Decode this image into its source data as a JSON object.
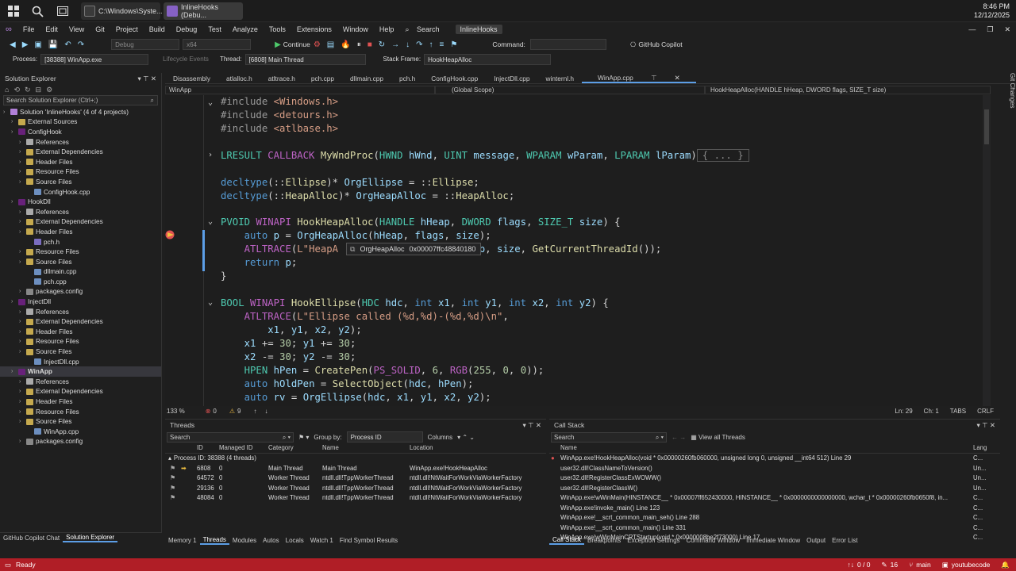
{
  "taskbar": {
    "tab1": "C:\\Windows\\Syste...",
    "tab2": "InlineHooks (Debu...",
    "time": "8:46 PM",
    "date": "12/12/2025"
  },
  "menu": [
    "File",
    "Edit",
    "View",
    "Git",
    "Project",
    "Build",
    "Debug",
    "Test",
    "Analyze",
    "Tools",
    "Extensions",
    "Window",
    "Help"
  ],
  "menu_search": "Search",
  "solution_badge": "InlineHooks",
  "toolbar": {
    "config": "Debug",
    "platform": "x64",
    "continue": "Continue",
    "command_label": "Command:",
    "copilot": "GitHub Copilot"
  },
  "procbar": {
    "process_label": "Process:",
    "process": "[38388] WinApp.exe",
    "lifecycle": "Lifecycle Events",
    "thread_label": "Thread:",
    "thread": "[6808] Main Thread",
    "frame_label": "Stack Frame:",
    "frame": "HookHeapAlloc"
  },
  "solution_explorer": {
    "title": "Solution Explorer",
    "search": "Search Solution Explorer (Ctrl+;)",
    "rows": [
      {
        "t": "Solution 'InlineHooks' (4 of 4 projects)",
        "d": 0,
        "c": "#b180d7"
      },
      {
        "t": "External Sources",
        "d": 1,
        "c": "#c5a94e"
      },
      {
        "t": "ConfigHook",
        "d": 1,
        "c": "#68217a"
      },
      {
        "t": "References",
        "d": 2,
        "c": "#aaaaaa"
      },
      {
        "t": "External Dependencies",
        "d": 2,
        "c": "#c5a94e"
      },
      {
        "t": "Header Files",
        "d": 2,
        "c": "#c5a94e"
      },
      {
        "t": "Resource Files",
        "d": 2,
        "c": "#c5a94e"
      },
      {
        "t": "Source Files",
        "d": 2,
        "c": "#c5a94e"
      },
      {
        "t": "ConfigHook.cpp",
        "d": 3,
        "c": "#6c8ebf"
      },
      {
        "t": "HookDll",
        "d": 1,
        "c": "#68217a"
      },
      {
        "t": "References",
        "d": 2,
        "c": "#aaaaaa"
      },
      {
        "t": "External Dependencies",
        "d": 2,
        "c": "#c5a94e"
      },
      {
        "t": "Header Files",
        "d": 2,
        "c": "#c5a94e"
      },
      {
        "t": "pch.h",
        "d": 3,
        "c": "#7a6cbf"
      },
      {
        "t": "Resource Files",
        "d": 2,
        "c": "#c5a94e"
      },
      {
        "t": "Source Files",
        "d": 2,
        "c": "#c5a94e"
      },
      {
        "t": "dllmain.cpp",
        "d": 3,
        "c": "#6c8ebf"
      },
      {
        "t": "pch.cpp",
        "d": 3,
        "c": "#6c8ebf"
      },
      {
        "t": "packages.config",
        "d": 2,
        "c": "#888888"
      },
      {
        "t": "InjectDll",
        "d": 1,
        "c": "#68217a"
      },
      {
        "t": "References",
        "d": 2,
        "c": "#aaaaaa"
      },
      {
        "t": "External Dependencies",
        "d": 2,
        "c": "#c5a94e"
      },
      {
        "t": "Header Files",
        "d": 2,
        "c": "#c5a94e"
      },
      {
        "t": "Resource Files",
        "d": 2,
        "c": "#c5a94e"
      },
      {
        "t": "Source Files",
        "d": 2,
        "c": "#c5a94e"
      },
      {
        "t": "InjectDll.cpp",
        "d": 3,
        "c": "#6c8ebf"
      },
      {
        "t": "WinApp",
        "d": 1,
        "c": "#68217a",
        "sel": true
      },
      {
        "t": "References",
        "d": 2,
        "c": "#aaaaaa"
      },
      {
        "t": "External Dependencies",
        "d": 2,
        "c": "#c5a94e"
      },
      {
        "t": "Header Files",
        "d": 2,
        "c": "#c5a94e"
      },
      {
        "t": "Resource Files",
        "d": 2,
        "c": "#c5a94e"
      },
      {
        "t": "Source Files",
        "d": 2,
        "c": "#c5a94e"
      },
      {
        "t": "WinApp.cpp",
        "d": 3,
        "c": "#6c8ebf"
      },
      {
        "t": "packages.config",
        "d": 2,
        "c": "#888888"
      }
    ],
    "bottom_tabs": [
      "GitHub Copilot Chat",
      "Solution Explorer"
    ]
  },
  "doc_tabs": [
    "Disassembly",
    "atlalloc.h",
    "atltrace.h",
    "pch.cpp",
    "dllmain.cpp",
    "pch.h",
    "ConfigHook.cpp",
    "InjectDll.cpp",
    "winternl.h",
    "WinApp.cpp"
  ],
  "navbar": {
    "project": "WinApp",
    "scope": "(Global Scope)",
    "member": "HookHeapAlloc(HANDLE hHeap, DWORD flags, SIZE_T size)"
  },
  "tooltip": {
    "name": "OrgHeapAlloc",
    "value": "0x00007ffc48840180"
  },
  "editor_status": {
    "zoom": "133 %",
    "errors": "0",
    "warnings": "9",
    "ln": "Ln: 29",
    "ch": "Ch: 1",
    "tabs": "TABS",
    "crlf": "CRLF"
  },
  "threads": {
    "title": "Threads",
    "search": "Search",
    "group_label": "Group by:",
    "group_value": "Process ID",
    "columns": "Columns",
    "headers": [
      "ID",
      "Managed ID",
      "Category",
      "Name",
      "Location"
    ],
    "group_row": "Process ID: 38388 (4 threads)",
    "rows": [
      {
        "id": "6808",
        "mid": "0",
        "cat": "Main Thread",
        "name": "Main Thread",
        "loc": "WinApp.exe!HookHeapAlloc",
        "cur": true
      },
      {
        "id": "64572",
        "mid": "0",
        "cat": "Worker Thread",
        "name": "ntdll.dll!TppWorkerThread",
        "loc": "ntdll.dll!NtWaitForWorkViaWorkerFactory"
      },
      {
        "id": "29136",
        "mid": "0",
        "cat": "Worker Thread",
        "name": "ntdll.dll!TppWorkerThread",
        "loc": "ntdll.dll!NtWaitForWorkViaWorkerFactory"
      },
      {
        "id": "48084",
        "mid": "0",
        "cat": "Worker Thread",
        "name": "ntdll.dll!TppWorkerThread",
        "loc": "ntdll.dll!NtWaitForWorkViaWorkerFactory"
      }
    ],
    "bottom_tabs": [
      "Memory 1",
      "Threads",
      "Modules",
      "Autos",
      "Locals",
      "Watch 1",
      "Find Symbol Results"
    ]
  },
  "callstack": {
    "title": "Call Stack",
    "search": "Search",
    "view_all": "View all Threads",
    "headers": [
      "Name",
      "Lang"
    ],
    "rows": [
      {
        "n": "WinApp.exe!HookHeapAlloc(void * 0x00000260fb060000, unsigned long 0, unsigned __int64 512) Line 29",
        "l": "C...",
        "cur": true
      },
      {
        "n": "user32.dll!ClassNameToVersion()",
        "l": "Un..."
      },
      {
        "n": "user32.dll!RegisterClassExWOWW()",
        "l": "Un..."
      },
      {
        "n": "user32.dll!RegisterClassW()",
        "l": "Un..."
      },
      {
        "n": "WinApp.exe!wWinMain(HINSTANCE__ * 0x00007ff652430000, HINSTANCE__ * 0x0000000000000000, wchar_t * 0x00000260fb0650f8, in...",
        "l": "C..."
      },
      {
        "n": "WinApp.exe!invoke_main() Line 123",
        "l": "C..."
      },
      {
        "n": "WinApp.exe!__scrt_common_main_seh() Line 288",
        "l": "C..."
      },
      {
        "n": "WinApp.exe!__scrt_common_main() Line 331",
        "l": "C..."
      },
      {
        "n": "WinApp.exe!wWinMainCRTStartup(void * 0x0000008be2f73000) Line 17",
        "l": "C..."
      }
    ],
    "bottom_tabs": [
      "Call Stack",
      "Breakpoints",
      "Exception Settings",
      "Command Window",
      "Immediate Window",
      "Output",
      "Error List"
    ]
  },
  "status": {
    "ready": "Ready",
    "lines": "0 / 0",
    "changes": "16",
    "branch": "main",
    "repo": "youtubecode"
  },
  "side_label": "Git Changes"
}
